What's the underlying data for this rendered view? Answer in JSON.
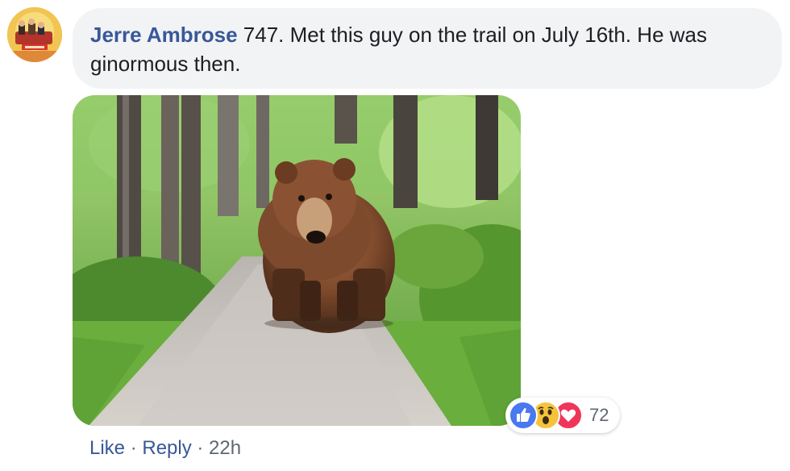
{
  "comment": {
    "author": "Jerre Ambrose",
    "text": " 747. Met this guy on the trail on July 16th. He was ginormous then.",
    "avatar_icon": "profile-photo"
  },
  "photo": {
    "icon": "bear-on-trail-photo"
  },
  "reactions": {
    "types": [
      "like",
      "wow",
      "love"
    ],
    "count": "72",
    "colors": {
      "like": "#4a78f0",
      "wow": "#f5c33b",
      "love": "#f0355b"
    }
  },
  "actions": {
    "like_label": "Like",
    "separator": " · ",
    "reply_label": "Reply",
    "time": "22h"
  },
  "colors": {
    "link": "#385898",
    "bubble": "#f2f3f5",
    "meta": "#606770"
  }
}
